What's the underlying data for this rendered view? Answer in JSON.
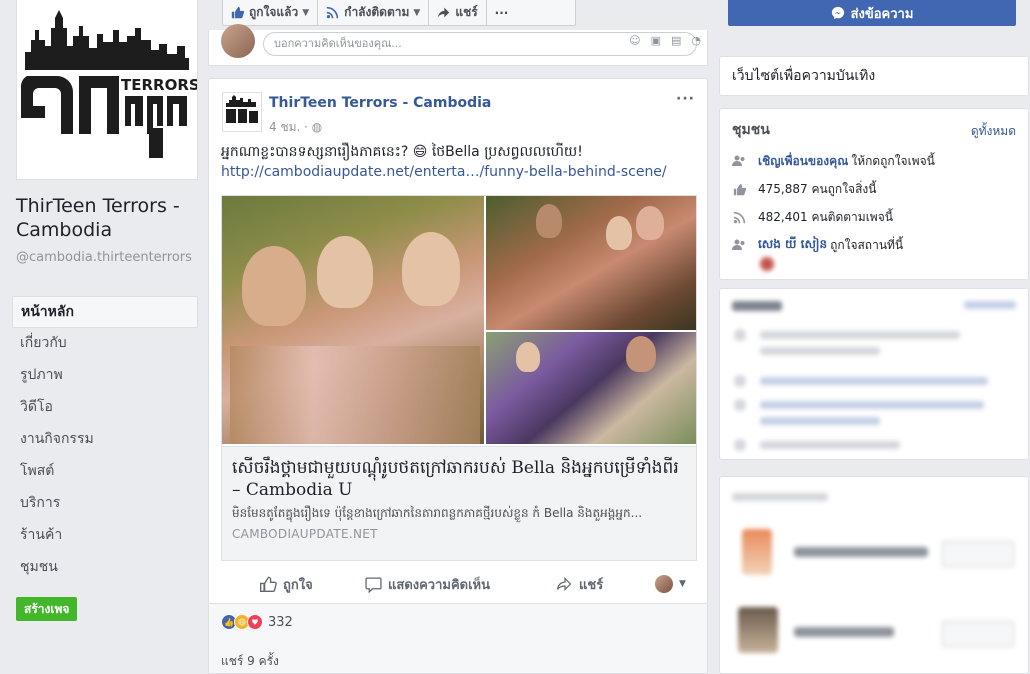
{
  "sidebar": {
    "page_name": "ThirTeen Terrors - Cambodia",
    "handle": "@cambodia.thirteenterrors",
    "logo_text": "TERRORS",
    "nav": [
      "หน้าหลัก",
      "เกี่ยวกับ",
      "รูปภาพ",
      "วิดีโอ",
      "งานกิจกรรม",
      "โพสต์",
      "บริการ",
      "ร้านค้า",
      "ชุมชน"
    ],
    "create_page": "สร้างเพจ"
  },
  "toolbar": {
    "liked": "ถูกใจแล้ว",
    "following": "กำลังติดตาม",
    "share": "แชร์",
    "more": "···"
  },
  "comment": {
    "placeholder": "บอกความคิดเห็นของคุณ..."
  },
  "post": {
    "author": "ThirTeen Terrors - Cambodia",
    "time": "4 ชม. · ",
    "text": "អ្នកណាខ្លះបានទស្សនារឿងភាគនេះ? 😄 ថៃBella ប្រសព្វលលហើយ!",
    "link": "http://cambodiaupdate.net/enterta…/funny-bella-behind-scene/",
    "card": {
      "title": "សើចរឹងថ្គាមជាមួយបណ្ដុំរូបថតក្រៅឆាករបស់ Bella និងអ្នកបម្រើទាំងពីរ – Cambodia U",
      "desc": "មិនមែនតូតែគ្នុងរឿងទេ ប៉ុន្តែខាងក្រៅឆាកនៃតារាពន្លកភាគថ្មីរបស់ខ្លួន កំ Bella និងតួអង្គអ្នក...",
      "domain": "CAMBODIAUPDATE.NET"
    },
    "actions": {
      "like": "ถูกใจ",
      "comment": "แสดงความคิดเห็น",
      "share": "แชร์"
    },
    "reaction_count": "332",
    "shares": "แชร์ 9 ครั้ง"
  },
  "right": {
    "send_message": "ส่งข้อความ",
    "category": "เว็บไซต์เพื่อความบันเทิง",
    "community": {
      "title": "ชุมชน",
      "see_all": "ดูทั้งหมด",
      "invite_link": "เชิญเพื่อนของคุณ",
      "invite_rest": "ให้กดถูกใจเพจนี้",
      "likes": "475,887 คนถูกใจสิ่งนี้",
      "follows": "482,401 คนติดตามเพจนี้",
      "friend_name": "សេង យី សៀន",
      "friend_rest": "ถูกใจสถานที่นี้"
    }
  },
  "colors": {
    "brand_blue": "#4267b2",
    "link": "#365899",
    "green": "#42b72a",
    "bg": "#e9ebee"
  }
}
